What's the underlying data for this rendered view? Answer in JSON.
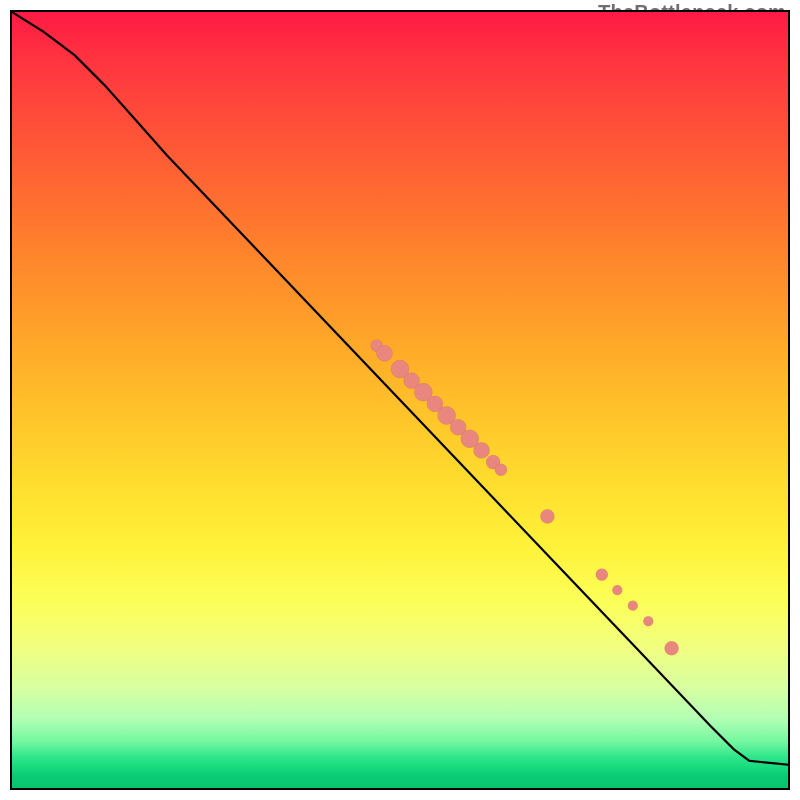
{
  "watermark": "TheBottleneck.com",
  "colors": {
    "line": "#000000",
    "dot": "#e9877e",
    "border": "#000000"
  },
  "chart_data": {
    "type": "line",
    "title": "",
    "xlabel": "",
    "ylabel": "",
    "xlim": [
      0,
      100
    ],
    "ylim": [
      0,
      100
    ],
    "grid": false,
    "legend": false,
    "line": {
      "name": "curve",
      "points": [
        {
          "x": 0,
          "y": 100
        },
        {
          "x": 4,
          "y": 97.5
        },
        {
          "x": 8,
          "y": 94.5
        },
        {
          "x": 12,
          "y": 90.5
        },
        {
          "x": 16,
          "y": 86
        },
        {
          "x": 20,
          "y": 81.5
        },
        {
          "x": 30,
          "y": 71
        },
        {
          "x": 40,
          "y": 60.5
        },
        {
          "x": 50,
          "y": 50
        },
        {
          "x": 60,
          "y": 39.5
        },
        {
          "x": 70,
          "y": 29
        },
        {
          "x": 80,
          "y": 18.5
        },
        {
          "x": 90,
          "y": 8
        },
        {
          "x": 93,
          "y": 5
        },
        {
          "x": 95,
          "y": 3.5
        },
        {
          "x": 100,
          "y": 3
        }
      ]
    },
    "scatter": {
      "name": "dots",
      "points": [
        {
          "x": 47,
          "y": 57,
          "r": 6
        },
        {
          "x": 48,
          "y": 56,
          "r": 8
        },
        {
          "x": 50,
          "y": 54,
          "r": 9
        },
        {
          "x": 51.5,
          "y": 52.5,
          "r": 8
        },
        {
          "x": 53,
          "y": 51,
          "r": 9
        },
        {
          "x": 54.5,
          "y": 49.5,
          "r": 8
        },
        {
          "x": 56,
          "y": 48,
          "r": 9
        },
        {
          "x": 57.5,
          "y": 46.5,
          "r": 8
        },
        {
          "x": 59,
          "y": 45,
          "r": 9
        },
        {
          "x": 60.5,
          "y": 43.5,
          "r": 8
        },
        {
          "x": 62,
          "y": 42,
          "r": 7
        },
        {
          "x": 63,
          "y": 41,
          "r": 6
        },
        {
          "x": 69,
          "y": 35,
          "r": 7
        },
        {
          "x": 76,
          "y": 27.5,
          "r": 6
        },
        {
          "x": 78,
          "y": 25.5,
          "r": 5
        },
        {
          "x": 80,
          "y": 23.5,
          "r": 5
        },
        {
          "x": 82,
          "y": 21.5,
          "r": 5
        },
        {
          "x": 85,
          "y": 18,
          "r": 7
        }
      ]
    }
  }
}
